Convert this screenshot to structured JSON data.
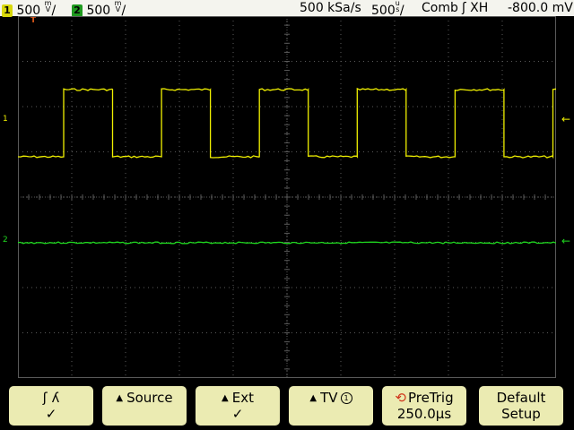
{
  "status_bar": {
    "ch1": {
      "number": "1",
      "scale": "500",
      "unit_top": "m",
      "unit_bottom": "V",
      "slash": "/"
    },
    "ch2": {
      "number": "2",
      "scale": "500",
      "unit_top": "m",
      "unit_bottom": "V",
      "slash": "/"
    },
    "sample_rate": "500 kSa/s",
    "timebase": {
      "scale": "500",
      "unit_top": "u",
      "unit_bottom": "s",
      "slash": "/"
    },
    "acq_mode": "Comb",
    "trigger": {
      "slope_icon": "rising-edge-icon",
      "glyph": "ʃ",
      "source": "XH"
    },
    "trigger_level": "-800.0 mV"
  },
  "markers": {
    "trigger_pos": "T",
    "ch1_left": "1",
    "ch2_left": "2",
    "ch1_right": "←",
    "ch2_right": "←"
  },
  "waveforms": {
    "ch1": {
      "color": "#f0f000",
      "shape": "square",
      "cycles_visible": 5.5,
      "high": 1.0,
      "low": 0.0
    },
    "ch2": {
      "color": "#1fd81f",
      "shape": "flat",
      "level": 0.0
    }
  },
  "softkeys": [
    {
      "line1": "ʃ   ʎ",
      "line2": "✓"
    },
    {
      "line1": "Source",
      "line2": ""
    },
    {
      "line1": "Ext",
      "line2": "✓"
    },
    {
      "line1": "TV",
      "line2": "",
      "badge": "1"
    },
    {
      "line1": "PreTrig",
      "line2": "250.0µs"
    },
    {
      "line1": "Default",
      "line2": "Setup"
    }
  ],
  "colors": {
    "ch1": "#f0f000",
    "ch2": "#1fd81f",
    "graticule": "#5a5a5a",
    "softkey_bg": "#ebebb2",
    "status_bg": "#f4f4ee"
  }
}
